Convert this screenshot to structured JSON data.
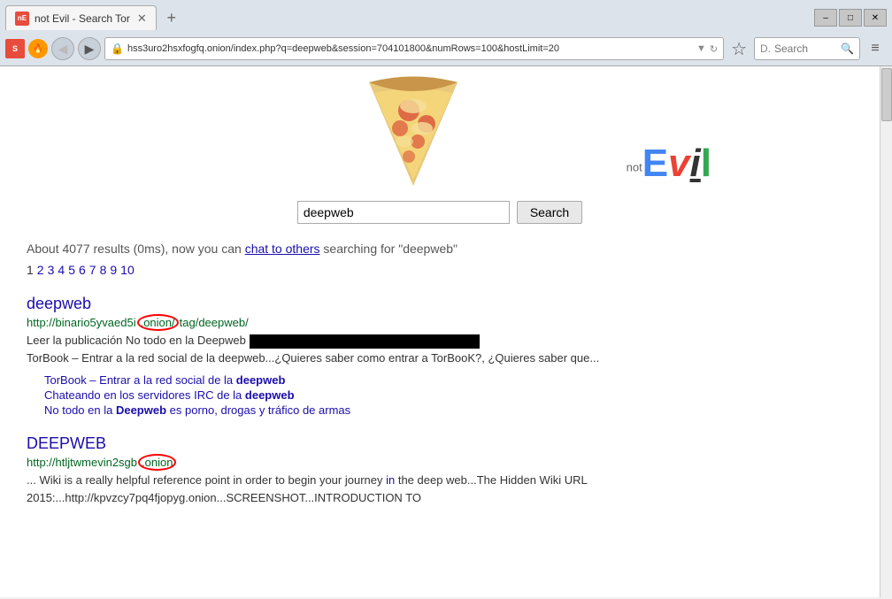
{
  "browser": {
    "tab_title": "not Evil - Search Tor",
    "tab_favicon": "nE",
    "address": "hss3uro2hsxfogfq.onion/index.php?q=deepweb&session=704101800&numRows=100&hostLimit=20",
    "nav_search_placeholder": "Search",
    "window_controls": [
      "–",
      "□",
      "✕"
    ]
  },
  "logo": {
    "not_prefix": "not",
    "evil_text": "Evil",
    "letters": [
      "E",
      "v",
      "i",
      "l"
    ]
  },
  "search": {
    "input_value": "deepweb",
    "button_label": "Search"
  },
  "results_summary": {
    "prefix": "About 4077 results (0ms), now you can ",
    "chat_link": "chat to others",
    "suffix": " searching for \"deepweb\""
  },
  "pagination": {
    "current": "1",
    "pages": [
      "2",
      "3",
      "4",
      "5",
      "6",
      "7",
      "8",
      "9",
      "10"
    ]
  },
  "results": [
    {
      "title": "deepweb",
      "url_parts": [
        "http://binario5yvaed5i",
        ".onion/",
        "tag/deepweb/"
      ],
      "url_circle": ".onion/",
      "desc_before_redact": "Leer la publicación No todo en la Deepweb ",
      "desc_after_redact": "",
      "desc2": "TorBook – Entrar a la red social de la deepweb...¿Quieres saber como entrar a TorBooK?, ¿Quieres saber que...",
      "sub_results": [
        "TorBook – Entrar a la red social de la deepweb",
        "Chateando en los servidores IRC de la deepweb",
        "No todo en la Deepweb es porno, drogas y tráfico de armas"
      ]
    },
    {
      "title": "DEEPWEB",
      "url_parts": [
        "http://htljtwmevin2sgb",
        ".onion"
      ],
      "url_circle": ".onion",
      "desc": "... Wiki is a really helpful reference point in order to begin your journey in the deep web...The Hidden Wiki URL 2015:...http://kpvzcy7pq4fjopyg.onion...SCREENSHOT...INTRODUCTION TO"
    }
  ]
}
